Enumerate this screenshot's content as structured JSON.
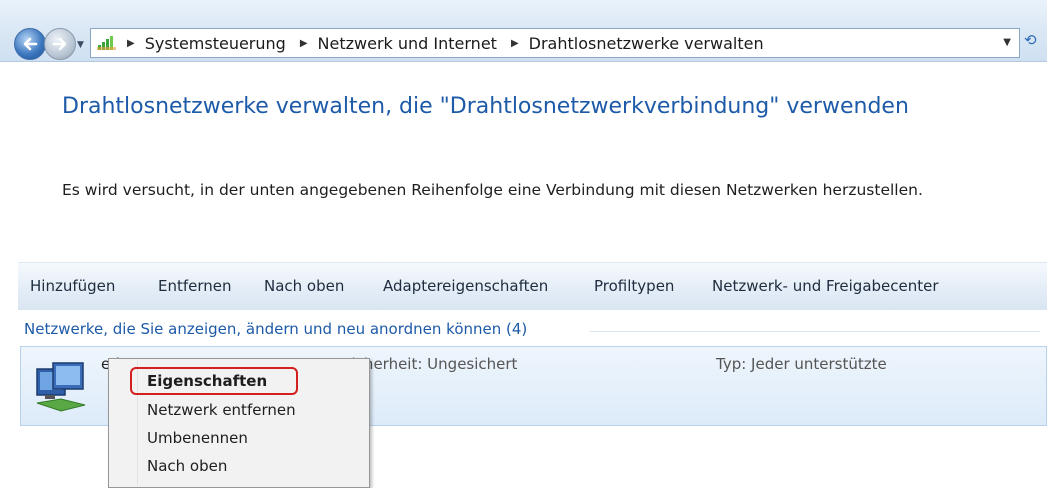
{
  "address_bar": {
    "breadcrumbs": [
      "Systemsteuerung",
      "Netzwerk und Internet",
      "Drahtlosnetzwerke verwalten"
    ]
  },
  "page": {
    "title": "Drahtlosnetzwerke verwalten, die \"Drahtlosnetzwerkverbindung\" verwenden",
    "description": "Es wird versucht, in der unten angegebenen Reihenfolge eine Verbindung mit diesen Netzwerken herzustellen."
  },
  "commands": [
    "Hinzufügen",
    "Entfernen",
    "Nach oben",
    "Adaptereigenschaften",
    "Profiltypen",
    "Netzwerk- und Freigabecenter"
  ],
  "group_header": "Netzwerke, die Sie anzeigen, ändern und neu anordnen können (4)",
  "network": {
    "name": "eduroam",
    "security": "Sicherheit: Ungesichert",
    "type": "Typ: Jeder unterstützte"
  },
  "context_menu": {
    "items": [
      "Eigenschaften",
      "Netzwerk entfernen",
      "Umbenennen",
      "Nach oben"
    ]
  },
  "colors": {
    "title_blue": "#1d5aa8",
    "highlight_red": "#d41f1f"
  }
}
